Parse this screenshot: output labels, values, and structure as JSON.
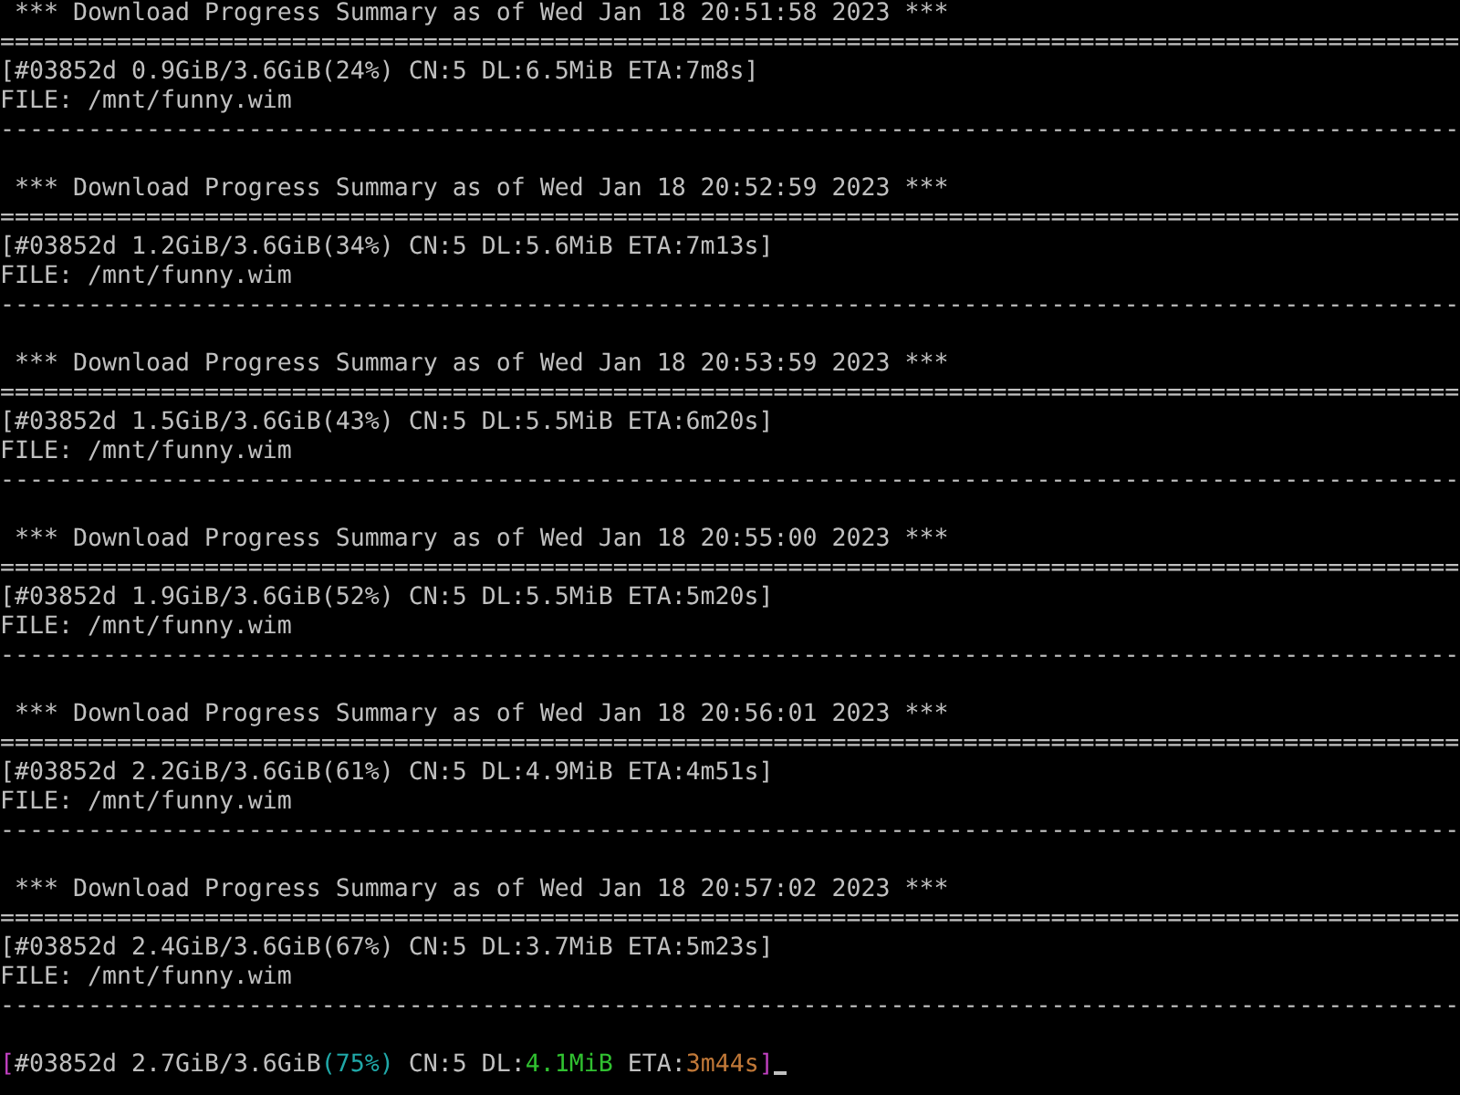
{
  "terminal": {
    "blocks": [
      {
        "heading": " *** Download Progress Summary as of Wed Jan 18 20:51:58 2023 ***",
        "double_rule": "====================================================================================================",
        "status": "[#03852d 0.9GiB/3.6GiB(24%) CN:5 DL:6.5MiB ETA:7m8s]",
        "file": "FILE: /mnt/funny.wim",
        "single_rule": "----------------------------------------------------------------------------------------------------"
      },
      {
        "heading": " *** Download Progress Summary as of Wed Jan 18 20:52:59 2023 ***",
        "double_rule": "====================================================================================================",
        "status": "[#03852d 1.2GiB/3.6GiB(34%) CN:5 DL:5.6MiB ETA:7m13s]",
        "file": "FILE: /mnt/funny.wim",
        "single_rule": "----------------------------------------------------------------------------------------------------"
      },
      {
        "heading": " *** Download Progress Summary as of Wed Jan 18 20:53:59 2023 ***",
        "double_rule": "====================================================================================================",
        "status": "[#03852d 1.5GiB/3.6GiB(43%) CN:5 DL:5.5MiB ETA:6m20s]",
        "file": "FILE: /mnt/funny.wim",
        "single_rule": "----------------------------------------------------------------------------------------------------"
      },
      {
        "heading": " *** Download Progress Summary as of Wed Jan 18 20:55:00 2023 ***",
        "double_rule": "====================================================================================================",
        "status": "[#03852d 1.9GiB/3.6GiB(52%) CN:5 DL:5.5MiB ETA:5m20s]",
        "file": "FILE: /mnt/funny.wim",
        "single_rule": "----------------------------------------------------------------------------------------------------"
      },
      {
        "heading": " *** Download Progress Summary as of Wed Jan 18 20:56:01 2023 ***",
        "double_rule": "====================================================================================================",
        "status": "[#03852d 2.2GiB/3.6GiB(61%) CN:5 DL:4.9MiB ETA:4m51s]",
        "file": "FILE: /mnt/funny.wim",
        "single_rule": "----------------------------------------------------------------------------------------------------"
      },
      {
        "heading": " *** Download Progress Summary as of Wed Jan 18 20:57:02 2023 ***",
        "double_rule": "====================================================================================================",
        "status": "[#03852d 2.4GiB/3.6GiB(67%) CN:5 DL:3.7MiB ETA:5m23s]",
        "file": "FILE: /mnt/funny.wim",
        "single_rule": "----------------------------------------------------------------------------------------------------"
      }
    ],
    "progress_line": {
      "segments": [
        {
          "text": "[",
          "color": "#c040c0"
        },
        {
          "text": "#03852d 2.7GiB/3.6GiB",
          "color": "#c0c0c0"
        },
        {
          "text": "(75%)",
          "color": "#20a8a8"
        },
        {
          "text": " CN:5 DL:",
          "color": "#c0c0c0"
        },
        {
          "text": "4.1MiB",
          "color": "#30c030"
        },
        {
          "text": " ETA:",
          "color": "#c0c0c0"
        },
        {
          "text": "3m44s",
          "color": "#c07838"
        },
        {
          "text": "]",
          "color": "#c040c0"
        }
      ],
      "cursor": true
    }
  }
}
